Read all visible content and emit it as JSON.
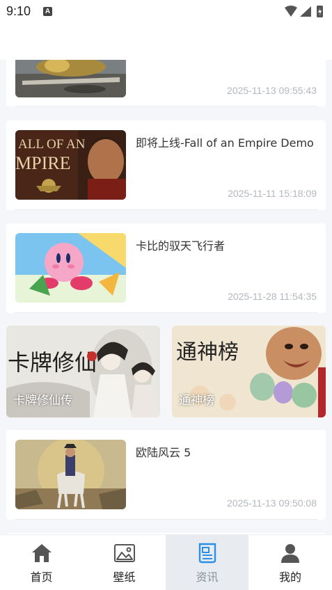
{
  "status_bar": {
    "time": "9:10",
    "notification_letter": "A"
  },
  "feed": {
    "items": [
      {
        "title": "",
        "date": "2025-11-13 09:55:43"
      },
      {
        "title": "即将上线-Fall of an Empire Demo",
        "date": "2025-11-11 15:18:09",
        "thumb_text_1": "ALL OF AN",
        "thumb_text_2": "MPIRE"
      },
      {
        "title": "卡比的驭天飞行者",
        "date": "2025-11-28 11:54:35"
      },
      {
        "title": "欧陆风云 5",
        "date": "2025-11-13 09:50:08"
      }
    ],
    "banners": [
      {
        "label": "卡牌修仙传",
        "art_text": "卡牌修仙"
      },
      {
        "label": "通神榜",
        "art_text": "通神榜"
      }
    ]
  },
  "bottom_nav": {
    "items": [
      {
        "label": "首页",
        "icon": "home-icon"
      },
      {
        "label": "壁纸",
        "icon": "image-icon"
      },
      {
        "label": "资讯",
        "icon": "news-icon",
        "active": true
      },
      {
        "label": "我的",
        "icon": "person-icon"
      }
    ]
  },
  "colors": {
    "accent": "#2a8fe6",
    "date": "#b3b8bf",
    "background": "#f4f6f9"
  }
}
